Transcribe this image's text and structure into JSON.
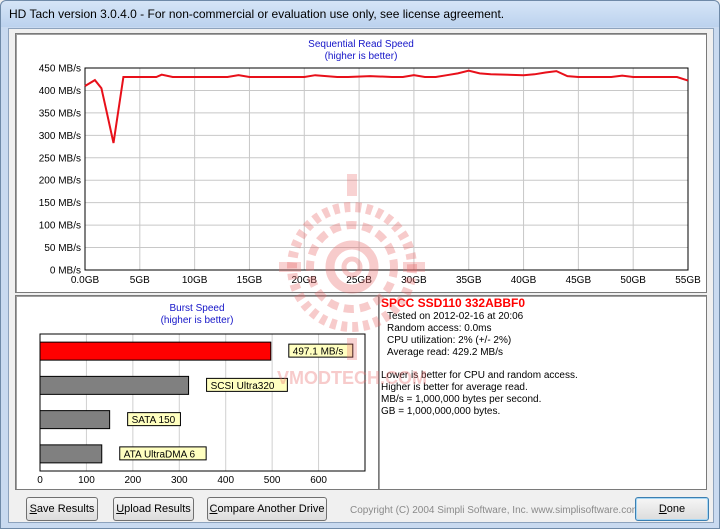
{
  "window": {
    "title": "HD Tach version 3.0.4.0  - For non-commercial or evaluation use only, see license agreement."
  },
  "seq_chart": {
    "title_line1": "Sequential Read Speed",
    "title_line2": "(higher is better)"
  },
  "burst_chart": {
    "title_line1": "Burst Speed",
    "title_line2": "(higher is better)"
  },
  "chart_data": [
    {
      "type": "line",
      "title": "Sequential Read Speed",
      "subtitle": "(higher is better)",
      "x_unit": "GB",
      "y_unit": "MB/s",
      "ylim": [
        0,
        450
      ],
      "xlim": [
        0,
        55
      ],
      "yticks": [
        "0 MB/s",
        "50 MB/s",
        "100 MB/s",
        "150 MB/s",
        "200 MB/s",
        "250 MB/s",
        "300 MB/s",
        "350 MB/s",
        "400 MB/s",
        "450 MB/s"
      ],
      "xticks": [
        "0.0GB",
        "5GB",
        "10GB",
        "15GB",
        "20GB",
        "25GB",
        "30GB",
        "35GB",
        "40GB",
        "45GB",
        "50GB",
        "55GB"
      ],
      "grid": true,
      "series": [
        {
          "color": "#e8101a",
          "x": [
            0,
            0.9,
            1.5,
            2.0,
            2.6,
            3.5,
            5,
            6.5,
            7,
            8,
            11,
            13,
            14,
            15,
            17,
            19,
            20,
            21,
            23,
            24,
            26,
            28,
            29,
            30,
            31,
            32,
            33,
            34,
            35,
            36,
            37,
            40,
            41,
            42,
            43,
            44,
            45,
            48,
            49,
            50,
            51,
            53,
            54,
            55
          ],
          "y": [
            410,
            423,
            405,
            350,
            283,
            430,
            430,
            430,
            435,
            430,
            430,
            430,
            434,
            430,
            430,
            430,
            430,
            434,
            430,
            430,
            432,
            430,
            430,
            434,
            430,
            430,
            434,
            438,
            444,
            438,
            436,
            434,
            436,
            440,
            443,
            432,
            430,
            430,
            433,
            430,
            430,
            430,
            430,
            422
          ]
        }
      ]
    },
    {
      "type": "bar",
      "title": "Burst Speed",
      "subtitle": "(higher is better)",
      "xlim": [
        0,
        700
      ],
      "xticks": [
        "0",
        "100",
        "200",
        "300",
        "400",
        "500",
        "600"
      ],
      "categories": [
        "497.1 MB/s",
        "SCSI Ultra320",
        "SATA 150",
        "ATA UltraDMA 6"
      ],
      "values": [
        497.1,
        320,
        150,
        133
      ],
      "colors": [
        "#ff0000",
        "#808080",
        "#808080",
        "#808080"
      ]
    }
  ],
  "results": {
    "drive_name": "SPCC SSD110 332ABBF0",
    "tested_on": "Tested on 2012-02-16 at 20:06",
    "random_access": "Random access: 0.0ms",
    "cpu_util": "CPU utilization: 2% (+/- 2%)",
    "avg_read": "Average read: 429.2 MB/s",
    "note1": "Lower is better for CPU and random access.",
    "note2": "Higher is better for average read.",
    "note3": "MB/s = 1,000,000 bytes per second.",
    "note4": "GB = 1,000,000,000 bytes."
  },
  "buttons": {
    "save_prefix": "S",
    "save_rest": "ave Results",
    "upload_prefix": "U",
    "upload_rest": "pload Results",
    "compare_prefix": "C",
    "compare_rest": "ompare Another Drive",
    "done_prefix": "D",
    "done_rest": "one"
  },
  "copyright": "Copyright (C) 2004 Simpli Software, Inc. www.simplisoftware.com",
  "watermark_text": "VMODTECH.COM"
}
